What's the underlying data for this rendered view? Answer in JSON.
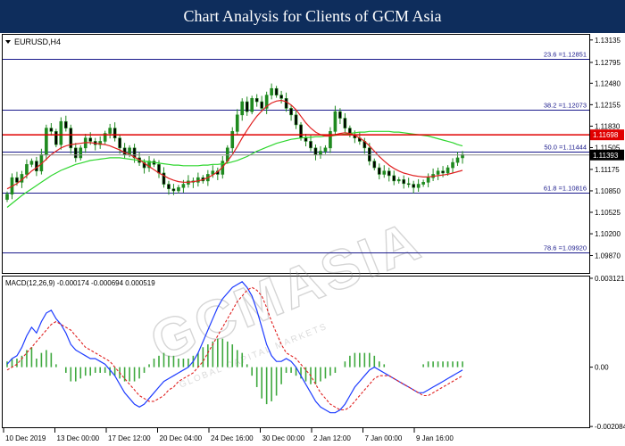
{
  "banner": {
    "title": "Chart Analysis for Clients of GCM Asia"
  },
  "chart_data": [
    {
      "type": "candlestick",
      "title": "EURUSD,H4",
      "ylim": [
        1.0962,
        1.132
      ],
      "y_ticks": [
        "1.13135",
        "1.12795",
        "1.12480",
        "1.12155",
        "1.11830",
        "1.11505",
        "1.11175",
        "1.10850",
        "1.10525",
        "1.10200",
        "1.09870"
      ],
      "y_tick_values": [
        1.13135,
        1.12795,
        1.1248,
        1.12155,
        1.1183,
        1.11505,
        1.11175,
        1.1085,
        1.10525,
        1.102,
        1.0987
      ],
      "x_ticks": [
        "10 Dec 2019",
        "13 Dec 00:00",
        "17 Dec 12:00",
        "20 Dec 04:00",
        "24 Dec 16:00",
        "30 Dec 00:00",
        "2 Jan 12:00",
        "7 Jan 00:00",
        "9 Jan 16:00"
      ],
      "current_price": "1.11393",
      "current_price_value": 1.11393,
      "resistance_level": "1.11698",
      "resistance_value": 1.11698,
      "fibonacci": [
        {
          "label": "23.6 =1.12851",
          "value": 1.12851
        },
        {
          "label": "38.2 =1.12073",
          "value": 1.12073
        },
        {
          "label": "50.0 =1.11444",
          "value": 1.11444
        },
        {
          "label": "61.8 =1.10816",
          "value": 1.10816
        },
        {
          "label": "78.6 =1.09920",
          "value": 1.0992
        }
      ],
      "close": [
        1.108,
        1.1105,
        1.1098,
        1.111,
        1.1125,
        1.113,
        1.1115,
        1.114,
        1.118,
        1.1175,
        1.1155,
        1.119,
        1.118,
        1.115,
        1.1135,
        1.115,
        1.1165,
        1.116,
        1.1155,
        1.116,
        1.1172,
        1.118,
        1.1165,
        1.115,
        1.114,
        1.115,
        1.1135,
        1.1128,
        1.112,
        1.113,
        1.1125,
        1.1112,
        1.1095,
        1.1088,
        1.1085,
        1.109,
        1.1095,
        1.11,
        1.1098,
        1.1105,
        1.11,
        1.111,
        1.1115,
        1.111,
        1.113,
        1.115,
        1.1175,
        1.12,
        1.122,
        1.1205,
        1.1225,
        1.122,
        1.121,
        1.123,
        1.124,
        1.123,
        1.1225,
        1.121,
        1.12,
        1.1185,
        1.1165,
        1.116,
        1.115,
        1.114,
        1.1145,
        1.115,
        1.1175,
        1.1205,
        1.1195,
        1.118,
        1.117,
        1.1165,
        1.116,
        1.115,
        1.113,
        1.112,
        1.111,
        1.1115,
        1.1108,
        1.11,
        1.1102,
        1.1096,
        1.1095,
        1.109,
        1.1095,
        1.1098,
        1.1105,
        1.111,
        1.1115,
        1.1112,
        1.112,
        1.1128,
        1.1135,
        1.114
      ],
      "ma_fast": [
        1.1088,
        1.1092,
        1.1096,
        1.1102,
        1.1108,
        1.1115,
        1.112,
        1.1126,
        1.1133,
        1.114,
        1.1145,
        1.115,
        1.1153,
        1.1155,
        1.1156,
        1.1157,
        1.1158,
        1.1158,
        1.1157,
        1.1156,
        1.1155,
        1.1153,
        1.115,
        1.1147,
        1.1143,
        1.114,
        1.1136,
        1.1132,
        1.1127,
        1.1122,
        1.1117,
        1.1112,
        1.1108,
        1.1104,
        1.1101,
        1.1099,
        1.1098,
        1.1098,
        1.1099,
        1.11,
        1.1102,
        1.1105,
        1.1109,
        1.1114,
        1.1121,
        1.113,
        1.114,
        1.1152,
        1.1165,
        1.1177,
        1.1188,
        1.1198,
        1.1206,
        1.1213,
        1.1218,
        1.1221,
        1.1222,
        1.122,
        1.1215,
        1.1208,
        1.1198,
        1.1188,
        1.118,
        1.1174,
        1.117,
        1.1168,
        1.1168,
        1.117,
        1.1172,
        1.1173,
        1.1172,
        1.1169,
        1.1165,
        1.116,
        1.1153,
        1.1145,
        1.1137,
        1.113,
        1.1124,
        1.1119,
        1.1115,
        1.1112,
        1.111,
        1.1108,
        1.1107,
        1.1106,
        1.1106,
        1.1107,
        1.1108,
        1.1109,
        1.111,
        1.1112,
        1.1114,
        1.1116
      ],
      "ma_slow": [
        1.106,
        1.1066,
        1.1072,
        1.1078,
        1.1083,
        1.1088,
        1.1093,
        1.1098,
        1.1103,
        1.1108,
        1.1112,
        1.1116,
        1.1119,
        1.1122,
        1.1125,
        1.1127,
        1.1129,
        1.1131,
        1.1132,
        1.1133,
        1.1134,
        1.1135,
        1.1135,
        1.1135,
        1.1134,
        1.1133,
        1.1132,
        1.1131,
        1.113,
        1.1129,
        1.1128,
        1.1127,
        1.1126,
        1.1125,
        1.1124,
        1.1124,
        1.1123,
        1.1123,
        1.1123,
        1.1123,
        1.1124,
        1.1124,
        1.1125,
        1.1125,
        1.1126,
        1.1127,
        1.1129,
        1.1131,
        1.1134,
        1.1137,
        1.1141,
        1.1145,
        1.1148,
        1.1151,
        1.1154,
        1.1157,
        1.1159,
        1.1161,
        1.1163,
        1.1164,
        1.1165,
        1.1166,
        1.1166,
        1.1167,
        1.1167,
        1.1168,
        1.1168,
        1.1169,
        1.117,
        1.1171,
        1.1172,
        1.1173,
        1.1174,
        1.1174,
        1.1175,
        1.1175,
        1.1175,
        1.1175,
        1.1175,
        1.1174,
        1.1174,
        1.1173,
        1.1172,
        1.1171,
        1.117,
        1.1169,
        1.1168,
        1.1166,
        1.1164,
        1.1162,
        1.116,
        1.1158,
        1.1155,
        1.1153
      ]
    },
    {
      "type": "macd",
      "title": "MACD(12,26,9) -0.000174 -0.000694 0.000519",
      "ylim": [
        -0.00208,
        0.00312
      ],
      "y_ticks": [
        "0.003121",
        "0.00",
        "-0.002084"
      ],
      "y_tick_values": [
        0.003121,
        0.0,
        -0.002084
      ],
      "macd": [
        0.0001,
        0.0003,
        0.0004,
        0.0007,
        0.0011,
        0.0014,
        0.0012,
        0.0016,
        0.0019,
        0.002,
        0.0017,
        0.0015,
        0.0012,
        0.0008,
        0.0006,
        0.0005,
        0.0004,
        0.0003,
        0.0003,
        0.0002,
        0.0001,
        -0.0001,
        -0.0003,
        -0.0006,
        -0.0009,
        -0.0011,
        -0.0013,
        -0.0014,
        -0.0013,
        -0.0011,
        -0.0009,
        -0.0007,
        -0.0005,
        -0.0004,
        -0.0003,
        -0.0002,
        -0.0001,
        0.0,
        0.0002,
        0.0005,
        0.0009,
        0.0013,
        0.0017,
        0.0021,
        0.0024,
        0.0026,
        0.0028,
        0.0029,
        0.003,
        0.0028,
        0.0025,
        0.002,
        0.0014,
        0.0008,
        0.0004,
        0.0002,
        0.0002,
        0.0003,
        0.0002,
        0.0,
        -0.0003,
        -0.0006,
        -0.0009,
        -0.0012,
        -0.0014,
        -0.0015,
        -0.0016,
        -0.0016,
        -0.0015,
        -0.0013,
        -0.001,
        -0.0007,
        -0.0005,
        -0.0003,
        -0.0001,
        0.0,
        -0.0001,
        -0.0002,
        -0.0003,
        -0.0004,
        -0.0005,
        -0.0006,
        -0.0007,
        -0.0008,
        -0.0009,
        -0.0009,
        -0.0008,
        -0.0007,
        -0.0006,
        -0.0005,
        -0.0004,
        -0.0003,
        -0.0002,
        -0.0001
      ],
      "signal": [
        -0.0001,
        0.0,
        0.0001,
        0.0003,
        0.0005,
        0.0007,
        0.0009,
        0.0011,
        0.0013,
        0.0015,
        0.0016,
        0.0015,
        0.0014,
        0.0013,
        0.0011,
        0.0009,
        0.0007,
        0.0006,
        0.0005,
        0.0004,
        0.0003,
        0.0002,
        0.0,
        -0.0002,
        -0.0004,
        -0.0006,
        -0.0008,
        -0.001,
        -0.0011,
        -0.0012,
        -0.0012,
        -0.0011,
        -0.001,
        -0.0008,
        -0.0007,
        -0.0005,
        -0.0004,
        -0.0003,
        -0.0002,
        0.0,
        0.0002,
        0.0005,
        0.0008,
        0.0011,
        0.0014,
        0.0017,
        0.002,
        0.0023,
        0.0025,
        0.0027,
        0.0028,
        0.0027,
        0.0025,
        0.0021,
        0.0016,
        0.0012,
        0.0008,
        0.0005,
        0.0004,
        0.0003,
        0.0001,
        -0.0001,
        -0.0003,
        -0.0006,
        -0.0009,
        -0.0011,
        -0.0013,
        -0.0014,
        -0.0015,
        -0.0015,
        -0.0014,
        -0.0012,
        -0.001,
        -0.0008,
        -0.0006,
        -0.0004,
        -0.0003,
        -0.0003,
        -0.0003,
        -0.0004,
        -0.0005,
        -0.0006,
        -0.0007,
        -0.0008,
        -0.0009,
        -0.001,
        -0.001,
        -0.0009,
        -0.0008,
        -0.0007,
        -0.0006,
        -0.0005,
        -0.0004,
        -0.0003
      ],
      "histogram": [
        0.0002,
        0.0003,
        0.0003,
        0.0004,
        0.0006,
        0.0007,
        0.0003,
        0.0005,
        0.0006,
        0.0005,
        0.0001,
        0.0,
        -0.0002,
        -0.0005,
        -0.0005,
        -0.0004,
        -0.0003,
        -0.0003,
        -0.0002,
        -0.0002,
        -0.0002,
        -0.0003,
        -0.0003,
        -0.0004,
        -0.0005,
        -0.0005,
        -0.0005,
        -0.0004,
        -0.0002,
        0.0001,
        0.0003,
        0.0004,
        0.0005,
        0.0004,
        0.0004,
        0.0003,
        0.0003,
        0.0003,
        0.0004,
        0.0005,
        0.0007,
        0.0008,
        0.0009,
        0.001,
        0.001,
        0.0009,
        0.0008,
        0.0006,
        0.0005,
        0.0001,
        -0.0003,
        -0.0007,
        -0.0011,
        -0.0013,
        -0.0012,
        -0.001,
        -0.0006,
        -0.0002,
        -0.0002,
        -0.0003,
        -0.0004,
        -0.0005,
        -0.0006,
        -0.0006,
        -0.0005,
        -0.0004,
        -0.0003,
        -0.0002,
        0.0,
        0.0002,
        0.0004,
        0.0005,
        0.0005,
        0.0005,
        0.0005,
        0.0004,
        0.0002,
        0.0001,
        0.0,
        0.0,
        0.0,
        0.0,
        0.0,
        0.0,
        0.0,
        0.0001,
        0.0002,
        0.0002,
        0.0002,
        0.0002,
        0.0002,
        0.0002,
        0.0002,
        0.0002
      ]
    }
  ],
  "watermark": {
    "text": "GCMASIA",
    "tagline": "GLOBAL CAPITAL MARKETS"
  },
  "colors": {
    "banner": "#0e2d5c",
    "candle_up": "#1f8a1f",
    "candle_down": "#1f8a1f",
    "ma_fast": "#e02020",
    "ma_slow": "#2ed62e",
    "fib": "#1a1a8c",
    "resistance": "#e00000",
    "macd": "#1e3cff",
    "signal": "#e02020",
    "hist": "#3ea83e"
  }
}
